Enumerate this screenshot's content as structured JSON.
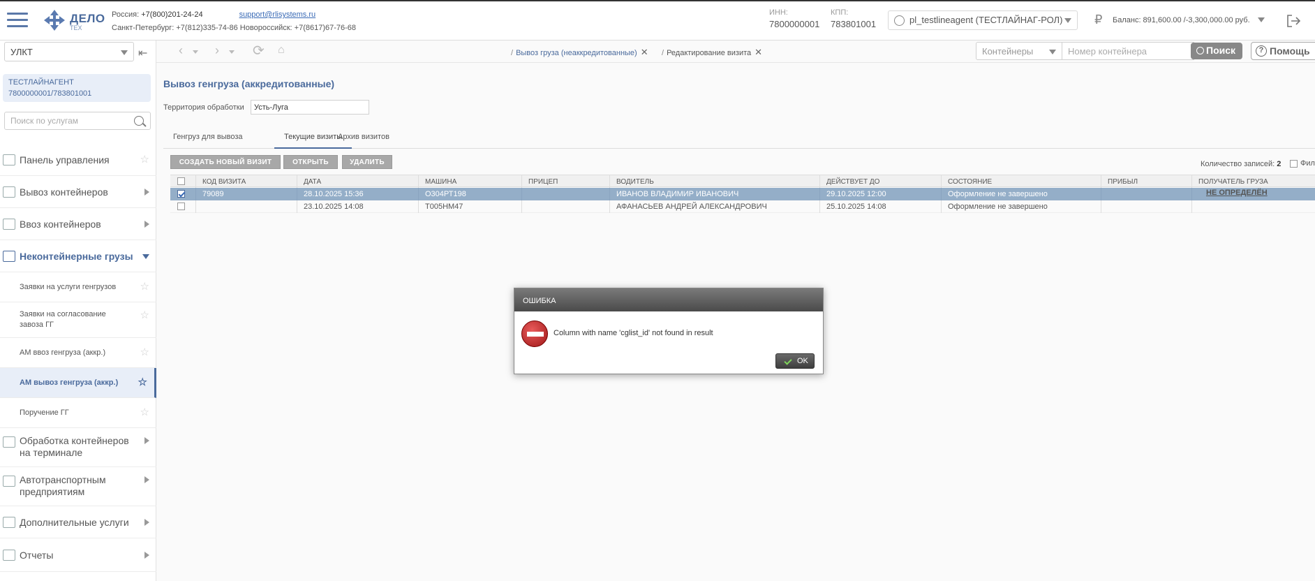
{
  "header": {
    "logo_text": "ДЕЛО",
    "logo_sub": "ТЕХ",
    "contact_line1_prefix": "Россия: ",
    "contact_line1_phone": "+7(800)201-24-24",
    "support_email": "support@rlisystems.ru",
    "contact_line2": "Санкт-Петербург: +7(812)335-74-86 Новороссийск: +7(8617)67-76-68",
    "inn_label": "ИНН:",
    "inn_value": "7800000001",
    "kpp_label": "КПП:",
    "kpp_value": "783801001",
    "user": "pl_testlineagent (ТЕСТЛАЙНАГ-РОЛ)",
    "balance": "Баланс: 891,600.00 /-3,300,000.00 руб.",
    "ruble_symbol": "₽"
  },
  "sidebar": {
    "org_select": "УЛКТ",
    "agent_name": "ТЕСТЛАЙНАГЕНТ",
    "agent_ids": "7800000001/783801001",
    "search_placeholder": "Поиск по услугам",
    "menu": [
      {
        "label": "Панель управления",
        "kind": "star"
      },
      {
        "label": "Вывоз контейнеров",
        "kind": "arrow"
      },
      {
        "label": "Ввоз контейнеров",
        "kind": "arrow"
      },
      {
        "label": "Неконтейнерные грузы",
        "kind": "open"
      }
    ],
    "submenu": [
      {
        "label": "Заявки на услуги генгрузов"
      },
      {
        "label": "Заявки на согласование завоза ГГ"
      },
      {
        "label": "АМ ввоз генгруза (аккр.)"
      },
      {
        "label": "АМ вывоз генгруза (аккр.)",
        "active": true
      },
      {
        "label": "Поручение ГГ"
      }
    ],
    "menu2": [
      {
        "label": "Обработка контейнеров на терминале"
      },
      {
        "label": "Автотранспортным предприятиям"
      },
      {
        "label": "Дополнительные услуги"
      },
      {
        "label": "Отчеты"
      }
    ]
  },
  "nav": {
    "crumb1": "Вывоз груза (неаккредитованные)",
    "crumb2": "Редактирование визита",
    "container_select": "Контейнеры",
    "container_placeholder": "Номер контейнера",
    "search_label": "Поиск",
    "help_label": "Помощь"
  },
  "main": {
    "title": "Вывоз генгруза (аккредитованные)",
    "territory_label": "Территория обработки",
    "territory_value": "Усть-Луга",
    "tabs": [
      "Генгруз для вывоза",
      "Текущие визиты",
      "Архив визитов"
    ],
    "buttons": [
      "СОЗДАТЬ НОВЫЙ ВИЗИТ",
      "ОТКРЫТЬ",
      "УДАЛИТЬ"
    ],
    "record_count_label": "Количество записей:",
    "record_count": "2",
    "filter_label": "Фил",
    "columns": [
      "КОД ВИЗИТА",
      "ДАТА",
      "МАШИНА",
      "ПРИЦЕП",
      "ВОДИТЕЛЬ",
      "ДЕЙСТВУЕТ ДО",
      "СОСТОЯНИЕ",
      "ПРИБЫЛ",
      "ПОЛУЧАТЕЛЬ ГРУЗА"
    ],
    "rows": [
      [
        "79089",
        "28.10.2025 15:36",
        "О304РТ198",
        "",
        "ИВАНОВ ВЛАДИМИР ИВАНОВИЧ",
        "29.10.2025 12:00",
        "Оформление не завершено",
        "",
        "НЕ ОПРЕДЕЛЁН"
      ],
      [
        "",
        "23.10.2025 14:08",
        "Т005НМ47",
        "",
        "АФАНАСЬЕВ АНДРЕЙ АЛЕКСАНДРОВИЧ",
        "25.10.2025 14:08",
        "Оформление не завершено",
        "",
        ""
      ]
    ]
  },
  "dialog": {
    "title": "ОШИБКА",
    "message": "Column with name 'cglist_id' not found in result",
    "ok": "OK"
  }
}
